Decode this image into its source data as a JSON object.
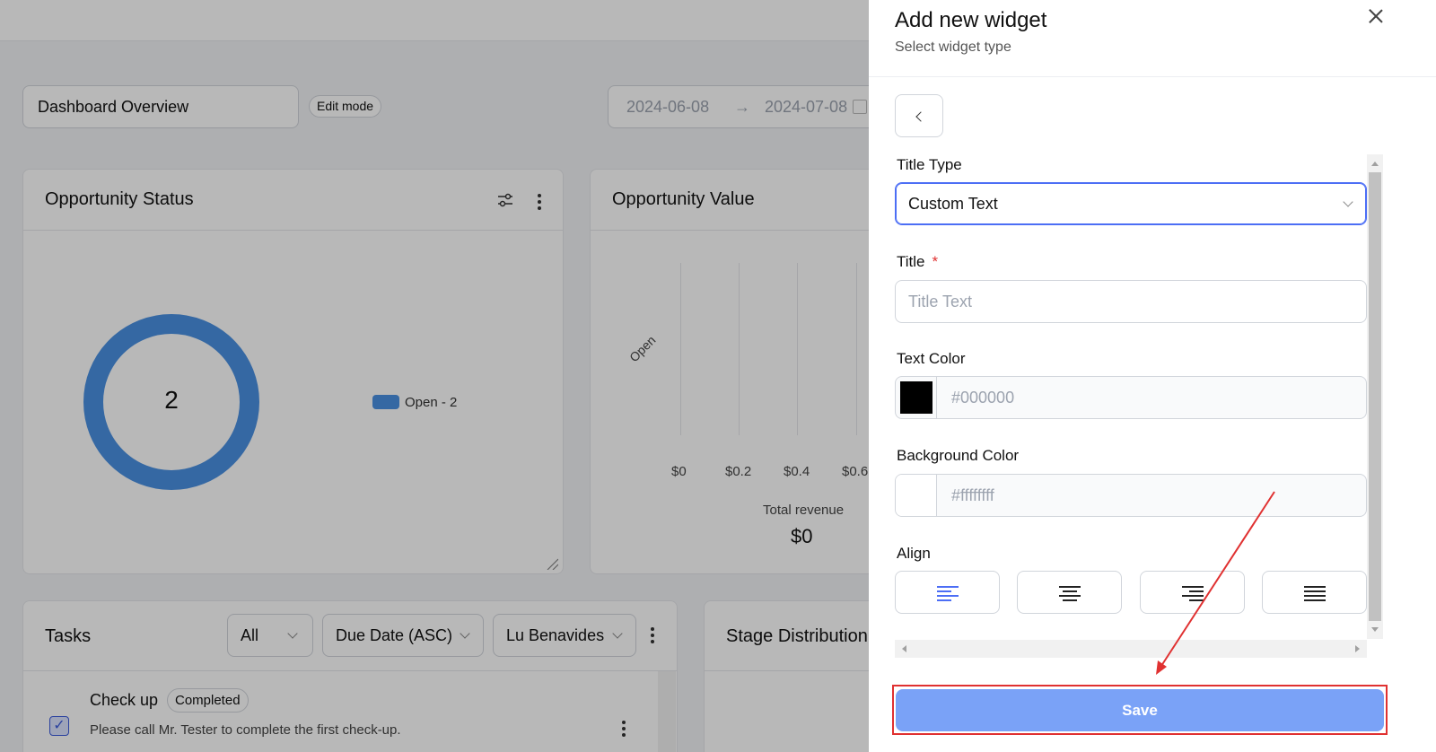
{
  "dashboard": {
    "title": "Dashboard Overview",
    "mode_badge": "Edit mode",
    "date_start": "2024-06-08",
    "date_arrow": "→",
    "date_end": "2024-07-08"
  },
  "opportunity_status": {
    "title": "Opportunity Status",
    "total": "2",
    "legend": "Open - 2",
    "color": "#4a90e2"
  },
  "opportunity_value": {
    "title": "Opportunity Value",
    "category": "Open",
    "ticks": [
      "$0",
      "$0.2",
      "$0.4",
      "$0.6"
    ],
    "total_label": "Total revenue",
    "total_value": "$0"
  },
  "tasks": {
    "title": "Tasks",
    "filter_all": "All",
    "sort": "Due Date (ASC)",
    "assignee": "Lu Benavides",
    "item_title": "Check up",
    "item_status": "Completed",
    "item_desc": "Please call Mr. Tester to complete the first check-up."
  },
  "stage_distribution": {
    "title": "Stage Distribution"
  },
  "drawer": {
    "title": "Add new widget",
    "subtitle": "Select widget type",
    "title_type_label": "Title Type",
    "title_type_value": "Custom Text",
    "title_label": "Title",
    "required_mark": "*",
    "title_placeholder": "Title Text",
    "text_color_label": "Text Color",
    "text_color_value": "#000000",
    "bg_color_label": "Background Color",
    "bg_color_value": "#ffffffff",
    "align_label": "Align",
    "align_options": [
      "left",
      "center",
      "right",
      "justify"
    ],
    "selected_align": "left",
    "save_label": "Save"
  },
  "colors": {
    "accent": "#4c6ef5",
    "save_button": "#7aa2f7",
    "annotation": "#e03131"
  }
}
